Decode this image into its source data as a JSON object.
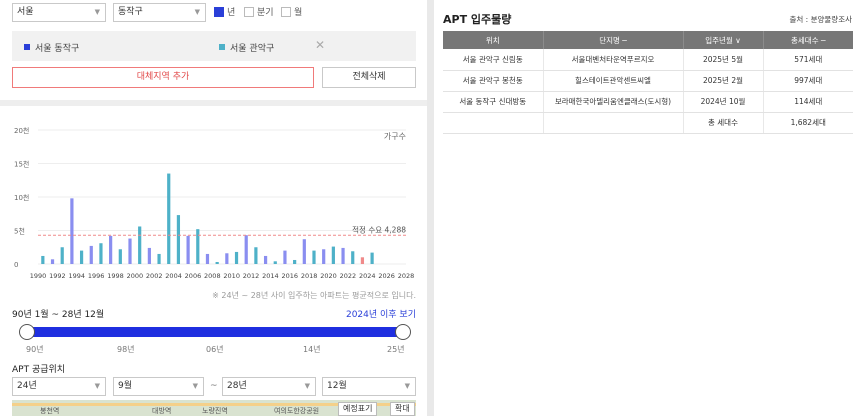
{
  "filters": {
    "city": "서울",
    "district": "동작구",
    "periods": [
      {
        "label": "년",
        "checked": true
      },
      {
        "label": "분기",
        "checked": false
      },
      {
        "label": "월",
        "checked": false
      }
    ]
  },
  "areas": [
    {
      "label": "서울 동작구",
      "color": "#2a3fd8"
    },
    {
      "label": "서울 관악구",
      "color": "#4eb1c8"
    }
  ],
  "buttons": {
    "add": "대체지역 추가",
    "delete_all": "전체삭제"
  },
  "chart_data": {
    "type": "bar",
    "series_label": "가구수",
    "x_ticks": [
      "1990",
      "1992",
      "1994",
      "1996",
      "1998",
      "2000",
      "2002",
      "2004",
      "2006",
      "2008",
      "2010",
      "2012",
      "2014",
      "2016",
      "2018",
      "2020",
      "2022",
      "2024",
      "2026",
      "2028"
    ],
    "y_ticks": [
      "0",
      "5천",
      "10천",
      "15천",
      "20천"
    ],
    "ylim": [
      0,
      20000
    ],
    "bars": [
      {
        "x": 1990,
        "value": 1200,
        "color": "#4eb1c8"
      },
      {
        "x": 1991,
        "value": 700,
        "color": "#8a8ef0"
      },
      {
        "x": 1992,
        "value": 2500,
        "color": "#4eb1c8"
      },
      {
        "x": 1993,
        "value": 9800,
        "color": "#8a8ef0"
      },
      {
        "x": 1994,
        "value": 2000,
        "color": "#4eb1c8"
      },
      {
        "x": 1995,
        "value": 2700,
        "color": "#8a8ef0"
      },
      {
        "x": 1996,
        "value": 3100,
        "color": "#4eb1c8"
      },
      {
        "x": 1997,
        "value": 4200,
        "color": "#8a8ef0"
      },
      {
        "x": 1998,
        "value": 2200,
        "color": "#4eb1c8"
      },
      {
        "x": 1999,
        "value": 3800,
        "color": "#8a8ef0"
      },
      {
        "x": 2000,
        "value": 5600,
        "color": "#4eb1c8"
      },
      {
        "x": 2001,
        "value": 2400,
        "color": "#8a8ef0"
      },
      {
        "x": 2002,
        "value": 1500,
        "color": "#4eb1c8"
      },
      {
        "x": 2003,
        "value": 13500,
        "color": "#4eb1c8"
      },
      {
        "x": 2004,
        "value": 7300,
        "color": "#4eb1c8"
      },
      {
        "x": 2005,
        "value": 4200,
        "color": "#8a8ef0"
      },
      {
        "x": 2006,
        "value": 5200,
        "color": "#4eb1c8"
      },
      {
        "x": 2007,
        "value": 1500,
        "color": "#8a8ef0"
      },
      {
        "x": 2008,
        "value": 300,
        "color": "#4eb1c8"
      },
      {
        "x": 2009,
        "value": 1600,
        "color": "#8a8ef0"
      },
      {
        "x": 2010,
        "value": 1800,
        "color": "#4eb1c8"
      },
      {
        "x": 2011,
        "value": 4300,
        "color": "#8a8ef0"
      },
      {
        "x": 2012,
        "value": 2500,
        "color": "#4eb1c8"
      },
      {
        "x": 2013,
        "value": 1200,
        "color": "#8a8ef0"
      },
      {
        "x": 2014,
        "value": 400,
        "color": "#4eb1c8"
      },
      {
        "x": 2015,
        "value": 2000,
        "color": "#8a8ef0"
      },
      {
        "x": 2016,
        "value": 600,
        "color": "#4eb1c8"
      },
      {
        "x": 2017,
        "value": 3700,
        "color": "#8a8ef0"
      },
      {
        "x": 2018,
        "value": 2000,
        "color": "#4eb1c8"
      },
      {
        "x": 2019,
        "value": 2200,
        "color": "#8a8ef0"
      },
      {
        "x": 2020,
        "value": 2600,
        "color": "#4eb1c8"
      },
      {
        "x": 2021,
        "value": 2400,
        "color": "#8a8ef0"
      },
      {
        "x": 2022,
        "value": 1900,
        "color": "#4eb1c8"
      },
      {
        "x": 2023,
        "value": 1000,
        "color": "#f08a8a"
      },
      {
        "x": 2024,
        "value": 1700,
        "color": "#4eb1c8"
      }
    ],
    "reference_line": {
      "value": 4288,
      "label": "적정 수요 4,288",
      "color": "#f08a8a"
    }
  },
  "footnote": "※ 24년 ~ 28년 사이 입주하는 아파트는 평균적으로 입니다.",
  "period": {
    "label": "90년 1월 ~ 28년 12월",
    "link": "2024년 이후 보기",
    "ticks": [
      "90년",
      "98년",
      "06년",
      "14년",
      "25년"
    ]
  },
  "supply": {
    "title": "APT 공급위치",
    "from_year": "24년",
    "from_month": "9월",
    "tilde": "~",
    "to_year": "28년",
    "to_month": "12월"
  },
  "map": {
    "labels": [
      "봉천역",
      "대방역",
      "노량진역",
      "여의도한강공원"
    ],
    "btn_toggle": "예정표기",
    "btn_zoom": "확대"
  },
  "apt_panel": {
    "title": "APT 입주물량",
    "source": "출처 : 분양물량조사",
    "headers": [
      "위치",
      "단지명 ─",
      "입주년월 ∨",
      "총세대수 ─"
    ],
    "rows": [
      [
        "서울 관악구 신림동",
        "서울대벤처타운역푸르지오",
        "2025년 5월",
        "571세대"
      ],
      [
        "서울 관악구 봉천동",
        "힐스테이트관악센트씨엘",
        "2025년 2월",
        "997세대"
      ],
      [
        "서울 동작구 신대방동",
        "보라매한국아델리움엔클래스(도시형)",
        "2024년 10월",
        "114세대"
      ]
    ],
    "total_label": "총 세대수",
    "total_value": "1,682세대"
  }
}
